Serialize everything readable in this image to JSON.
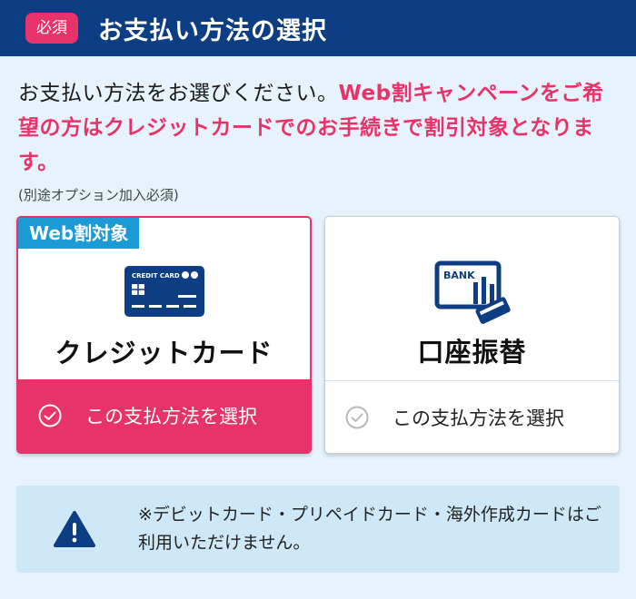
{
  "header": {
    "badge": "必須",
    "title": "お支払い方法の選択"
  },
  "intro": {
    "normal": "お支払い方法をお選びください。",
    "highlight": "Web割キャンペーンをご希望の方はクレジットカードでのお手続きで割引対象となります。"
  },
  "note": "(別途オプション加入必須)",
  "cards": [
    {
      "tag": "Web割対象",
      "icon": "credit-card-icon",
      "icon_text": "CREDIT CARD",
      "name": "クレジットカード",
      "select_label": "この支払方法を選択",
      "selected": true
    },
    {
      "icon": "bank-transfer-icon",
      "icon_text": "BANK",
      "name": "口座振替",
      "select_label": "この支払方法を選択",
      "selected": false
    }
  ],
  "warning": {
    "icon": "warning-icon",
    "text": "※デビットカード・プリペイドカード・海外作成カードはご利用いただけません。"
  },
  "colors": {
    "header_bg": "#0d3d82",
    "accent_pink": "#e8336a",
    "tag_blue": "#1c9ad6",
    "page_bg": "#e6f3fc",
    "warning_bg": "#cfe8f7"
  }
}
